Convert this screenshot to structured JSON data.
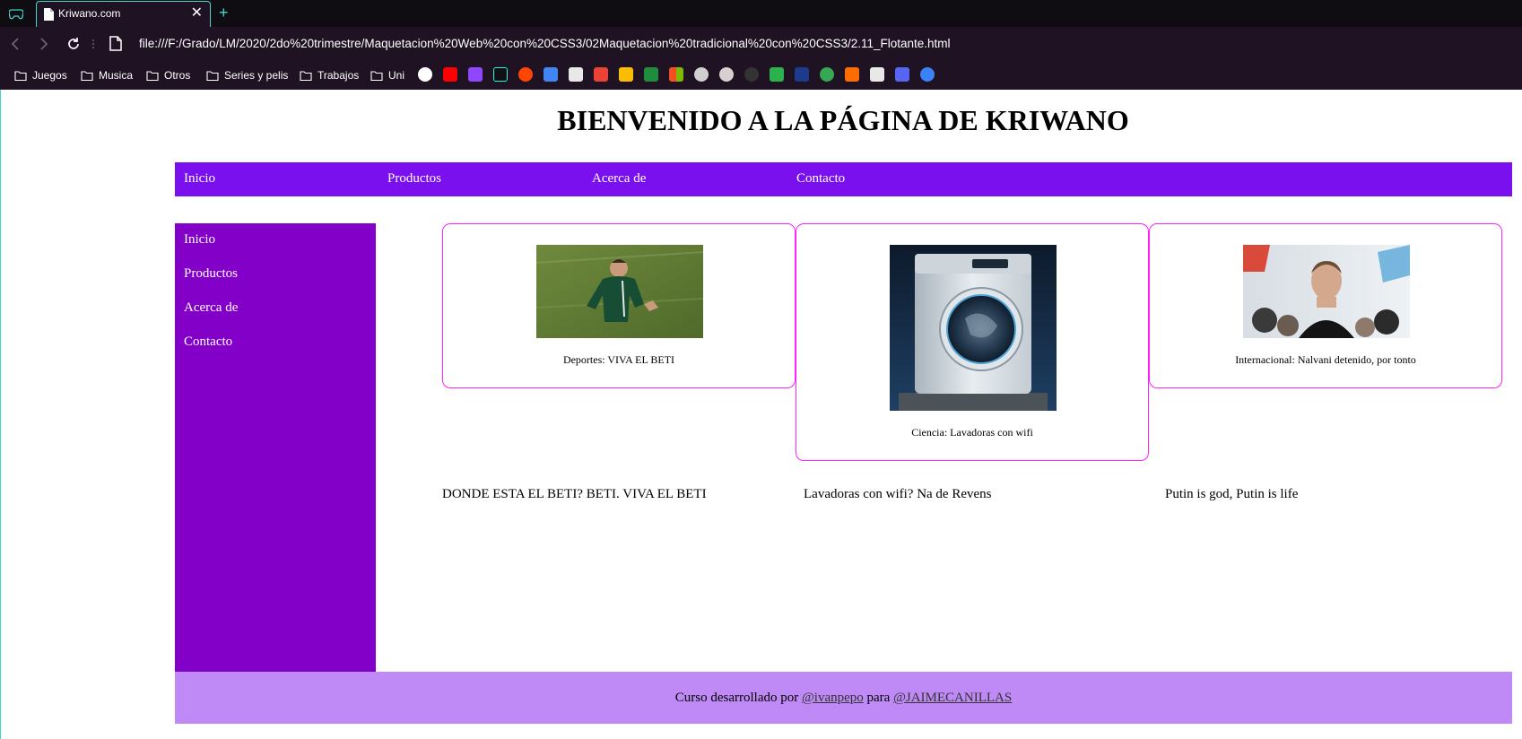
{
  "browser": {
    "tab_title": "Kriwano.com",
    "tab_close": "✕",
    "new_tab": "+",
    "url": "file:///F:/Grado/LM/2020/2do%20trimestre/Maquetacion%20Web%20con%20CSS3/02Maquetacion%20tradicional%20con%20CSS3/2.11_Flotante.html",
    "bookmark_folders": [
      "Juegos",
      "Musica",
      "Otros",
      "Series y pelis",
      "Trabajos",
      "Uni"
    ],
    "bookmark_icons": [
      "google-icon",
      "youtube-icon",
      "twitch-icon",
      "tiktok-icon",
      "reddit-icon",
      "translate-icon",
      "doc-icon",
      "gmail-icon",
      "drive-icon",
      "classroom-icon",
      "microsoft-icon",
      "avatar-icon",
      "sevilla-icon",
      "github-icon",
      "feedly-icon",
      "fcm-icon",
      "q-icon",
      "ft-icon",
      "doc2-icon",
      "discord-icon",
      "c-icon"
    ]
  },
  "site": {
    "title": "BIENVENIDO A LA PÁGINA DE KRIWANO",
    "topnav": [
      "Inicio",
      "Productos",
      "Acerca de",
      "Contacto"
    ],
    "sidenav": [
      "Inicio",
      "Productos",
      "Acerca de",
      "Contacto"
    ],
    "cards": [
      {
        "caption": "Deportes: VIVA EL BETI",
        "image": "soccer-player-photo"
      },
      {
        "caption": "Ciencia: Lavadoras con wifi",
        "image": "washing-machine-photo"
      },
      {
        "caption": "Internacional: Nalvani detenido, por tonto",
        "image": "protest-man-photo"
      }
    ],
    "paragraphs": [
      "DONDE ESTA EL BETI? BETI. VIVA EL BETI",
      "Lavadoras con wifi? Na de Revens",
      "Putin is god, Putin is life"
    ],
    "footer": {
      "text_before": "Curso desarrollado por ",
      "link1": "@ivanpepo",
      "text_middle": " para ",
      "link2": "@JAIMECANILLAS"
    }
  },
  "colors": {
    "topnav_bg": "#7b10ee",
    "sidebar_bg": "#8300c8",
    "footer_bg": "#bf8af5",
    "card_border": "#ff22ff",
    "chrome_accent": "#3fd8c8"
  }
}
